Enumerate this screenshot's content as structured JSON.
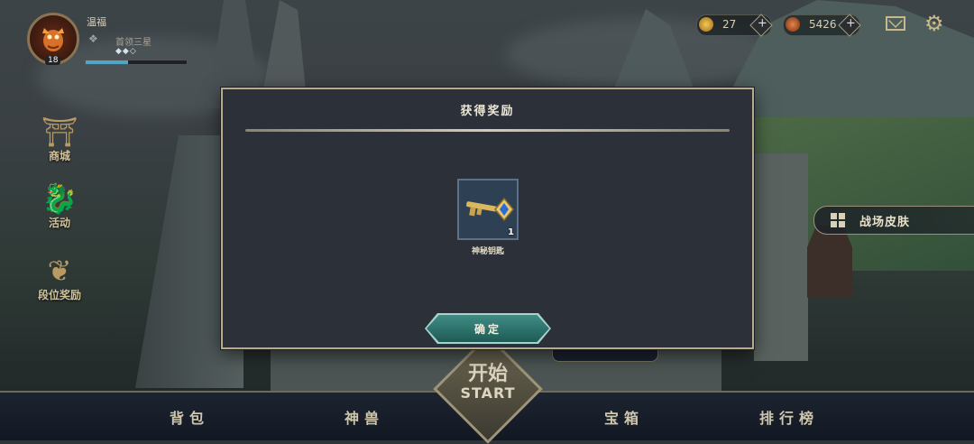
{
  "profile": {
    "name": "温福",
    "rank": "首领三星",
    "level": "18",
    "rank_stars": "◆◆◇",
    "xp_fraction": 0.42
  },
  "currency": [
    {
      "icon": "gem-icon",
      "value": "27",
      "color": "#d79a2a"
    },
    {
      "icon": "coin-icon",
      "value": "5426",
      "color": "#c15a2a"
    }
  ],
  "side_menu": [
    {
      "icon": "shop-gate-icon",
      "label": "商城"
    },
    {
      "icon": "dragon-icon",
      "label": "活动"
    },
    {
      "icon": "wings-icon",
      "label": "段位奖励"
    }
  ],
  "skin_button": {
    "label": "战场皮肤"
  },
  "modal": {
    "title": "获得奖励",
    "item": {
      "icon": "key-icon",
      "name": "神秘钥匙",
      "count": "1"
    },
    "confirm_label": "确定"
  },
  "bottom_nav": [
    {
      "label": "背包"
    },
    {
      "label": "神兽"
    },
    {
      "label": "宝箱"
    },
    {
      "label": "排行榜"
    }
  ],
  "start_button": {
    "label_cn": "开始",
    "label_en": "START"
  },
  "colors": {
    "accent_gold": "#b7ab8c",
    "teal_button": "#3f8d86",
    "panel_bg": "#2b3039"
  }
}
